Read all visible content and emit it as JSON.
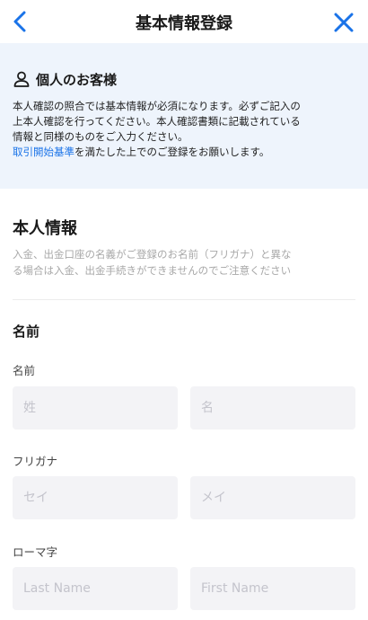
{
  "header": {
    "title": "基本情報登録",
    "back_icon": "chevron-left-icon",
    "close_icon": "close-icon",
    "accent_color": "#1a73e8"
  },
  "notice": {
    "icon": "person-icon",
    "title": "個人のお客様",
    "line1": "本人確認の照合では基本情報が必須になります。必ずご記入の",
    "line2": "上本人確認を行ってください。本人確認書類に記載されている",
    "line3": "情報と同様のものをご入力ください。",
    "link_text": "取引開始基準",
    "line4_rest": "を満たした上でのご登録をお願いします。",
    "background_color": "#eef4fc"
  },
  "section": {
    "title": "本人情報",
    "note_line1": "入金、出金口座の名義がご登録のお名前（フリガナ）と異な",
    "note_line2": "る場合は入金、出金手続きができませんのでご注意ください"
  },
  "name_group": {
    "title": "名前",
    "kanji": {
      "label": "名前",
      "last_placeholder": "姓",
      "first_placeholder": "名"
    },
    "kana": {
      "label": "フリガナ",
      "last_placeholder": "セイ",
      "first_placeholder": "メイ"
    },
    "roman": {
      "label": "ローマ字",
      "last_placeholder": "Last Name",
      "first_placeholder": "First Name"
    }
  }
}
